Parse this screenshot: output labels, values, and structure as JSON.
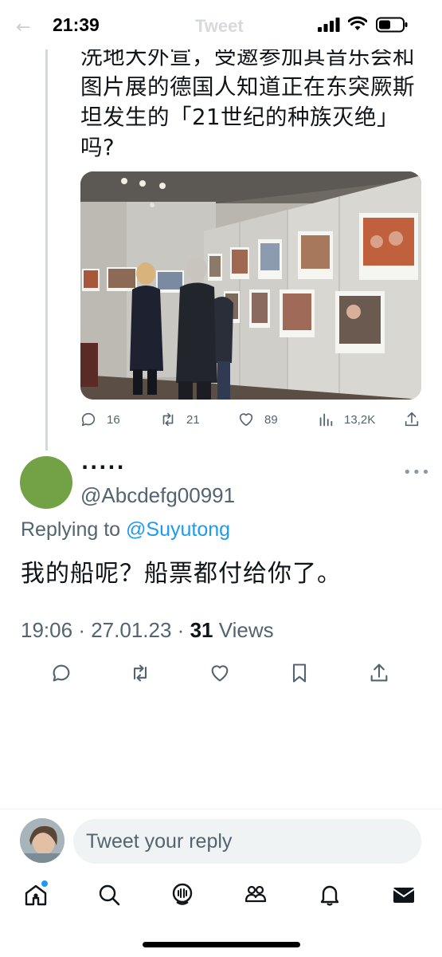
{
  "status_bar": {
    "time": "21:39",
    "ghost_title": "Tweet",
    "icons": [
      "back-arrow-icon",
      "signal-icon",
      "wifi-icon",
      "battery-icon"
    ]
  },
  "parent_tweet": {
    "text_lines": [
      "洗地大外宣，受邀参加其音乐会和",
      "图片展的德国人知道正在东突厥斯",
      "坦发生的「21世纪的种族灭绝」",
      "吗?"
    ],
    "image": "gallery-photo",
    "stats": {
      "replies": "16",
      "retweets": "21",
      "likes": "89",
      "views": "13,2K"
    }
  },
  "reply_tweet": {
    "display_name": "·····",
    "handle": "@Abcdefg00991",
    "replying_prefix": "Replying to",
    "replying_to": "@Suyutong",
    "text": "我的船呢？船票都付给你了。",
    "time": "19:06",
    "separator": "·",
    "date": "27.01.23",
    "views_count": "31",
    "views_label": "Views",
    "avatar_color": "#73a145"
  },
  "composer": {
    "placeholder": "Tweet your reply"
  },
  "nav": {
    "items": [
      "home-icon",
      "search-icon",
      "spaces-icon",
      "communities-icon",
      "notifications-icon",
      "messages-icon"
    ]
  },
  "colors": {
    "accent": "#1d9bf0",
    "secondary_text": "#536471",
    "text": "#0f1419"
  }
}
